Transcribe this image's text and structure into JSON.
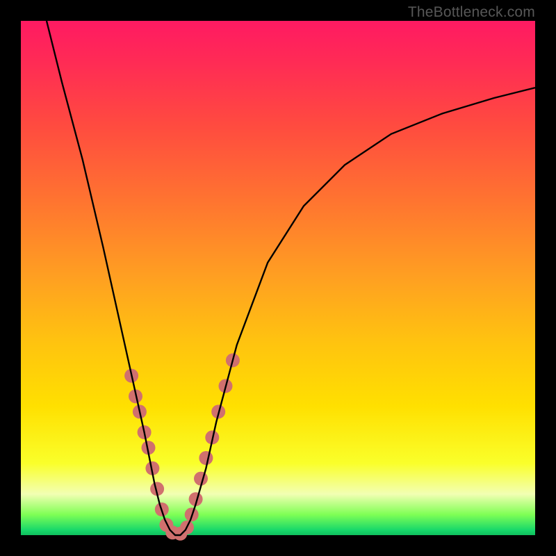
{
  "brand": {
    "watermark": "TheBottleneck.com"
  },
  "chart_data": {
    "type": "line",
    "title": "",
    "xlabel": "",
    "ylabel": "",
    "xlim": [
      0,
      100
    ],
    "ylim": [
      0,
      100
    ],
    "grid": false,
    "legend": false,
    "annotations": [],
    "series": [
      {
        "name": "bottleneck-curve",
        "color": "#000000",
        "x": [
          5,
          8,
          12,
          16,
          20,
          22,
          24,
          25,
          26,
          27,
          28,
          29,
          30,
          31,
          32,
          33,
          34,
          36,
          38,
          42,
          48,
          55,
          63,
          72,
          82,
          92,
          100
        ],
        "y": [
          100,
          88,
          73,
          56,
          38,
          29,
          20,
          15,
          10,
          6,
          3,
          1,
          0,
          0,
          1,
          3,
          6,
          13,
          22,
          37,
          53,
          64,
          72,
          78,
          82,
          85,
          87
        ]
      }
    ],
    "markers": {
      "name": "highlight-dots",
      "color": "#d0706e",
      "radius": 10,
      "points": [
        {
          "x": 21.5,
          "y": 31
        },
        {
          "x": 22.3,
          "y": 27
        },
        {
          "x": 23.1,
          "y": 24
        },
        {
          "x": 24.0,
          "y": 20
        },
        {
          "x": 24.8,
          "y": 17
        },
        {
          "x": 25.6,
          "y": 13
        },
        {
          "x": 26.5,
          "y": 9
        },
        {
          "x": 27.4,
          "y": 5
        },
        {
          "x": 28.3,
          "y": 2
        },
        {
          "x": 29.5,
          "y": 0.5
        },
        {
          "x": 31.0,
          "y": 0.3
        },
        {
          "x": 32.3,
          "y": 1.5
        },
        {
          "x": 33.2,
          "y": 4
        },
        {
          "x": 34.0,
          "y": 7
        },
        {
          "x": 35.0,
          "y": 11
        },
        {
          "x": 36.0,
          "y": 15
        },
        {
          "x": 37.2,
          "y": 19
        },
        {
          "x": 38.4,
          "y": 24
        },
        {
          "x": 39.8,
          "y": 29
        },
        {
          "x": 41.2,
          "y": 34
        }
      ]
    }
  }
}
